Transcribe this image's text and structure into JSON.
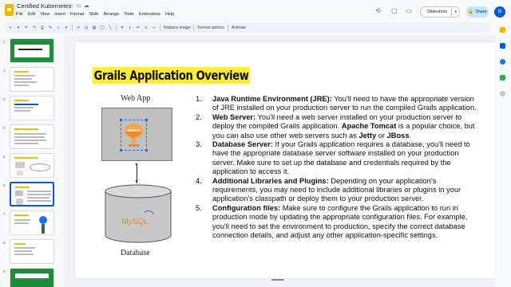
{
  "app": {
    "doc_title": "Certified Kubernetes",
    "menu": [
      "File",
      "Edit",
      "View",
      "Insert",
      "Format",
      "Slide",
      "Arrange",
      "Tools",
      "Extensions",
      "Help"
    ],
    "slideshow_label": "Slideshow",
    "share_label": "Share",
    "avatar_letter": "B"
  },
  "toolbar": {
    "replace_image": "Replace image",
    "format_options": "Format options",
    "animate": "Animate"
  },
  "filmstrip": {
    "slide_numbers": [
      "1",
      "2",
      "3",
      "4",
      "5",
      "6",
      "7",
      "8",
      "9",
      "10"
    ],
    "selected_index": 5
  },
  "slide": {
    "title": "Grails Application Overview",
    "diagram": {
      "web_app_label": "Web App",
      "database_label": "Database",
      "logo_text": "GRAILS",
      "db_logo_text": "MySQL"
    },
    "items": [
      {
        "num": "1.",
        "head": "Java Runtime Environment (JRE):",
        "text": " You'll need to have the appropriate version of JRE installed on your production server to run the compiled Grails application."
      },
      {
        "num": "2.",
        "head": "Web Server:",
        "text": " You'll need a web server installed on your production server to deploy the compiled Grails application. ",
        "bold2": "Apache Tomcat",
        "text2": " is a popular choice, but you can also use other web servers such as ",
        "bold3": "Jetty",
        "text3": " or ",
        "bold4": "JBoss",
        "text4": "."
      },
      {
        "num": "3.",
        "head": "Database Server:",
        "text": " If your Grails application requires a database, you'll need to have the appropriate database server software installed on your production server. Make sure to set up the database and credentials required by the application to access it."
      },
      {
        "num": "4.",
        "head": "Additional Libraries and Plugins:",
        "text": " Depending on your application's requirements, you may need to include additional libraries or plugins in your application's classpath or deploy them to your production server."
      },
      {
        "num": "5.",
        "head": "Configuration files:",
        "text": " Make sure to configure the Grails application to run in production mode by updating the appropriate configuration files. For example, you'll need to set the environment to production, specify the correct database connection details, and adjust any other application-specific settings."
      }
    ]
  },
  "colors": {
    "accent": "#0b57d0",
    "share_bg": "#c2e7ff",
    "title_highlight": "#ffeb3b"
  },
  "icons": [
    "star-icon",
    "move-to-folder-icon",
    "cloud-status-icon",
    "history-icon",
    "comment-icon",
    "camera-icon",
    "add-icon",
    "undo-icon",
    "redo-icon",
    "print-icon",
    "paint-format-icon",
    "zoom-icon",
    "select-icon",
    "textbox-icon",
    "image-icon",
    "shape-icon",
    "line-icon",
    "crop-icon",
    "mask-icon",
    "border-color-icon",
    "border-weight-icon",
    "border-dash-icon"
  ]
}
